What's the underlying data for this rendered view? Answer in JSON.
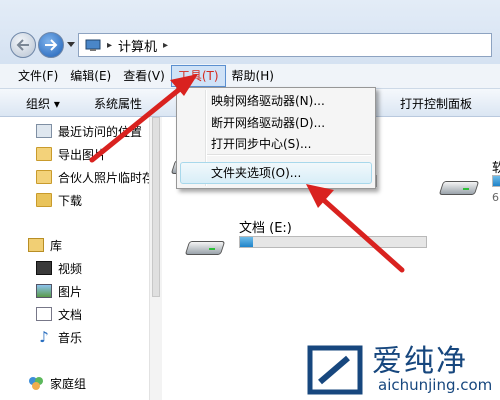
{
  "addressbar": {
    "separator": "▸",
    "crumb": "计算机",
    "crumb_caret": "▸"
  },
  "menubar": {
    "items": [
      {
        "label": "文件(F)"
      },
      {
        "label": "编辑(E)"
      },
      {
        "label": "查看(V)"
      },
      {
        "label": "工具(T)"
      },
      {
        "label": "帮助(H)"
      }
    ]
  },
  "toolbar": {
    "organize": "组织 ▾",
    "system_properties": "系统属性",
    "open_control_panel": "打开控制面板"
  },
  "navpane": {
    "items": [
      {
        "label": "最近访问的位置"
      },
      {
        "label": "导出图片"
      },
      {
        "label": "合伙人照片临时存"
      },
      {
        "label": "下载"
      },
      {
        "label": "库"
      },
      {
        "label": "视频"
      },
      {
        "label": "图片"
      },
      {
        "label": "文档"
      },
      {
        "label": "音乐"
      },
      {
        "label": "家庭组"
      }
    ]
  },
  "content": {
    "drive_e_label": "文档 (E:)",
    "drive_e_usage": 0.07,
    "right_partial_label": "软",
    "right_partial_detail": "6"
  },
  "tools_menu": {
    "items": [
      {
        "label": "映射网络驱动器(N)..."
      },
      {
        "label": "断开网络驱动器(D)..."
      },
      {
        "label": "打开同步中心(S)..."
      },
      {
        "label": "文件夹选项(O)..."
      }
    ],
    "highlighted": "文件夹选项(O)..."
  },
  "watermark": {
    "title": "爱纯净",
    "url": "aichunjing.com"
  },
  "colors": {
    "arrow": "#d9221f",
    "accent": "#1f83c9",
    "watermark": "#17477e"
  }
}
